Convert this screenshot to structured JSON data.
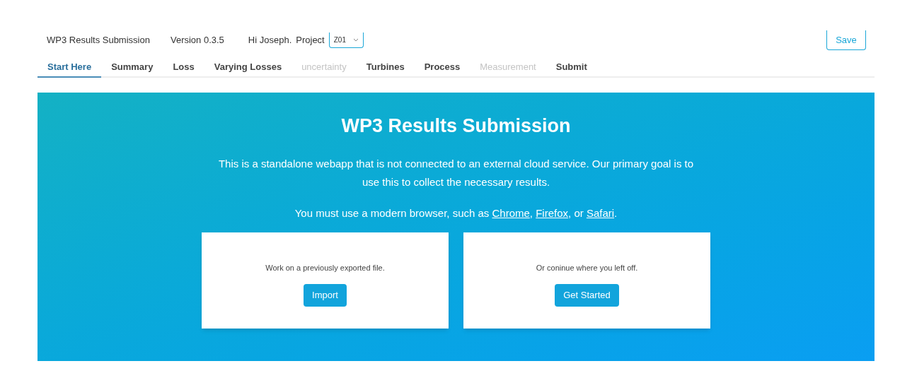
{
  "header": {
    "app_title": "WP3 Results Submission",
    "version": "Version 0.3.5",
    "greeting": "Hi Joseph.",
    "project_label": "Project",
    "project_value": "Z01",
    "save_button": "Save"
  },
  "tabs": [
    {
      "label": "Start Here",
      "selected": true,
      "disabled": false
    },
    {
      "label": "Summary",
      "selected": false,
      "disabled": false
    },
    {
      "label": "Loss",
      "selected": false,
      "disabled": false
    },
    {
      "label": "Varying Losses",
      "selected": false,
      "disabled": false
    },
    {
      "label": "uncertainty",
      "selected": false,
      "disabled": true
    },
    {
      "label": "Turbines",
      "selected": false,
      "disabled": false
    },
    {
      "label": "Process",
      "selected": false,
      "disabled": false
    },
    {
      "label": "Measurement",
      "selected": false,
      "disabled": true
    },
    {
      "label": "Submit",
      "selected": false,
      "disabled": false
    }
  ],
  "hero": {
    "title": "WP3 Results Submission",
    "intro": "This is a standalone webapp that is not connected to an external cloud service. Our primary goal is to use this to collect the necessary results.",
    "browser_note": [
      {
        "kind": "text",
        "text": "You must use a modern browser, such as "
      },
      {
        "kind": "link",
        "text": "Chrome"
      },
      {
        "kind": "text",
        "text": ", "
      },
      {
        "kind": "link",
        "text": "Firefox"
      },
      {
        "kind": "text",
        "text": ", or "
      },
      {
        "kind": "link",
        "text": "Safari"
      },
      {
        "kind": "text",
        "text": "."
      }
    ],
    "cards": [
      {
        "text": "Work on a previously exported file.",
        "button": "Import"
      },
      {
        "text": "Or coninue where you left off.",
        "button": "Get Started"
      }
    ]
  }
}
